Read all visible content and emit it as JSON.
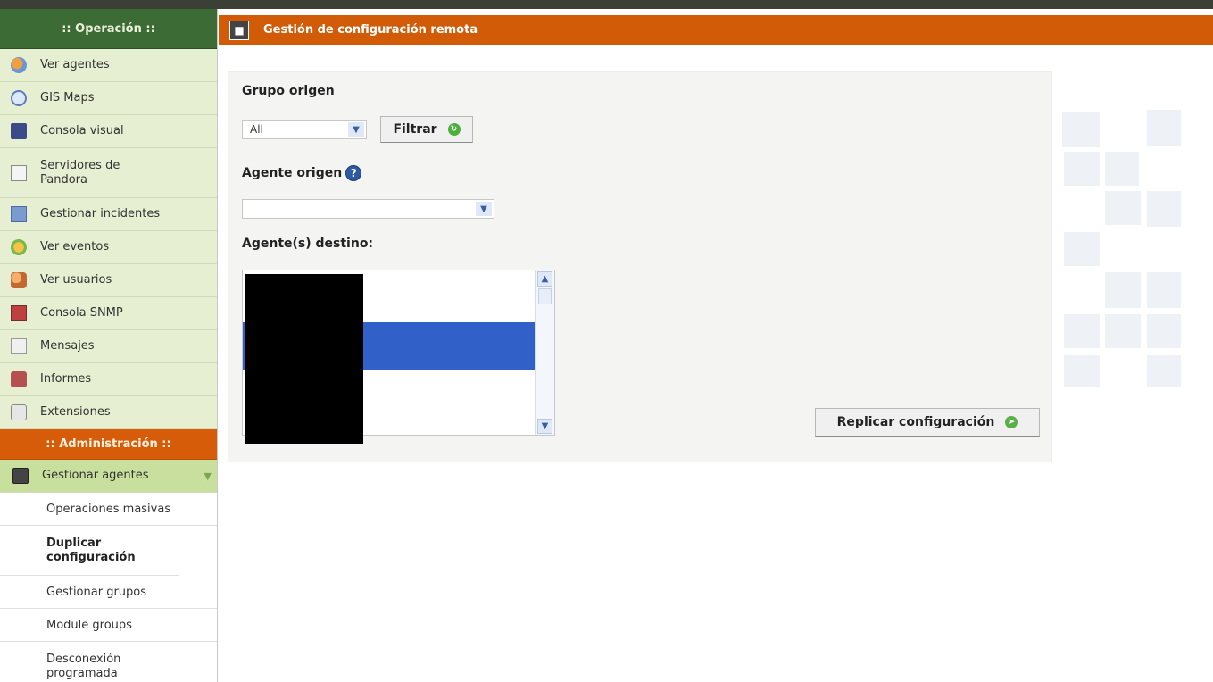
{
  "sidebar": {
    "operation_header": ":: Operación ::",
    "admin_header": ":: Administración ::",
    "items": [
      {
        "label": "Ver agentes",
        "icon": "agents-icon"
      },
      {
        "label": "GIS Maps",
        "icon": "globe-icon"
      },
      {
        "label": "Consola visual",
        "icon": "monitor-icon"
      },
      {
        "label": "Servidores de Pandora",
        "icon": "server-icon"
      },
      {
        "label": "Gestionar incidentes",
        "icon": "incident-icon"
      },
      {
        "label": "Ver eventos",
        "icon": "events-icon"
      },
      {
        "label": "Ver usuarios",
        "icon": "users-icon"
      },
      {
        "label": "Consola SNMP",
        "icon": "snmp-icon"
      },
      {
        "label": "Mensajes",
        "icon": "envelope-icon"
      },
      {
        "label": "Informes",
        "icon": "reports-icon"
      },
      {
        "label": "Extensiones",
        "icon": "extensions-icon"
      }
    ],
    "admin_items": [
      {
        "label": "Gestionar agentes",
        "icon": "manage-agents-icon"
      }
    ],
    "sub_items": [
      {
        "label": "Operaciones masivas"
      },
      {
        "label": "Duplicar configuración",
        "active": true
      },
      {
        "label": "Gestionar grupos"
      },
      {
        "label": "Module groups"
      },
      {
        "label": "Desconexión programada"
      }
    ]
  },
  "header": {
    "title": "Gestión de configuración remota"
  },
  "form": {
    "source_group_label": "Grupo origen",
    "source_group_value": "All",
    "filter_button": "Filtrar",
    "source_agent_label": "Agente origen",
    "source_agent_value": "",
    "target_agents_label": "Agente(s) destino:",
    "replicate_button": "Replicar configuración"
  },
  "colors": {
    "accent_orange": "#d15b07",
    "sidebar_green": "#3d6b35",
    "sidebar_item_bg": "#e6efd2",
    "selection_blue": "#3060c8"
  }
}
